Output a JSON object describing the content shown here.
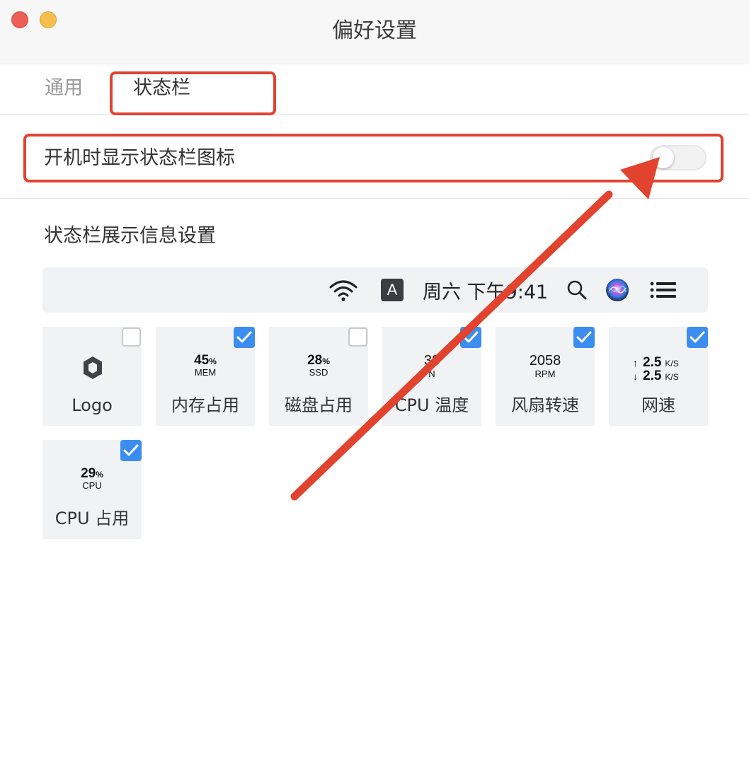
{
  "window": {
    "title": "偏好设置"
  },
  "tabs": [
    {
      "label": "通用",
      "active": false
    },
    {
      "label": "状态栏",
      "active": true
    }
  ],
  "toggle": {
    "label": "开机时显示状态栏图标",
    "on": false
  },
  "section": {
    "title": "状态栏展示信息设置"
  },
  "menubar_preview": {
    "input_letter": "A",
    "datetime": "周六 下午9:41",
    "icons": [
      "wifi-icon",
      "input-source-icon",
      "search-icon",
      "siri-icon",
      "control-center-icon"
    ]
  },
  "items": [
    {
      "label": "Logo",
      "checked": false,
      "preview": {
        "kind": "logo"
      }
    },
    {
      "label": "内存占用",
      "checked": true,
      "preview": {
        "value": "45",
        "unit": "%",
        "sub": "MEM"
      }
    },
    {
      "label": "磁盘占用",
      "checked": false,
      "preview": {
        "value": "28",
        "unit": "%",
        "sub": "SSD"
      }
    },
    {
      "label": "CPU 温度",
      "checked": true,
      "preview": {
        "value": "38",
        "sub": "N"
      }
    },
    {
      "label": "风扇转速",
      "checked": true,
      "preview": {
        "value": "2058",
        "sub": "RPM"
      }
    },
    {
      "label": "网速",
      "checked": true,
      "preview": {
        "up": "2.5",
        "down": "2.5",
        "unit": "K/S"
      }
    },
    {
      "label": "CPU 占用",
      "checked": true,
      "preview": {
        "value": "29",
        "unit": "%",
        "sub": "CPU"
      }
    }
  ],
  "colors": {
    "accent_checkbox": "#3c8df0",
    "annotation_red": "#e2432e",
    "tile_bg": "#f1f2f4"
  }
}
